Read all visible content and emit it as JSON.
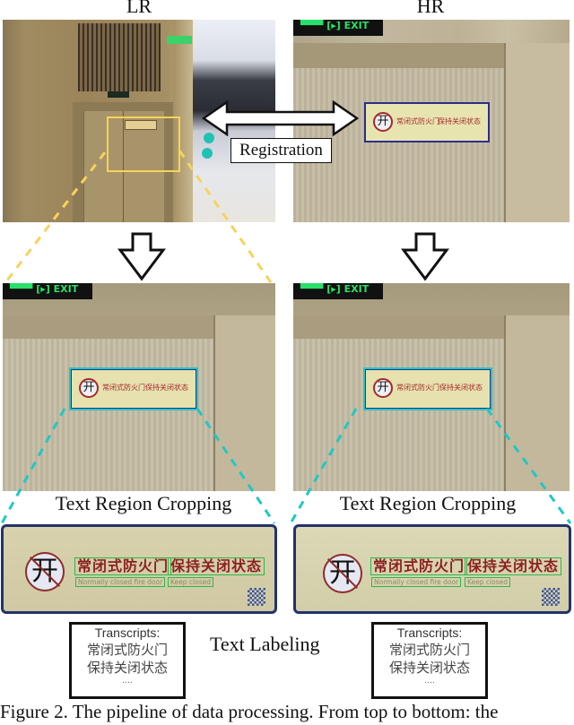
{
  "figure": {
    "column_labels": {
      "left": "LR",
      "right": "HR"
    },
    "registration_label": "Registration",
    "cropping_label_left": "Text Region Cropping",
    "cropping_label_right": "Text Region Cropping",
    "labeling_label": "Text Labeling",
    "caption": "Figure 2. The pipeline of data processing. From top to bottom: the"
  },
  "photos": {
    "exit_sign_text": "▀▀▀ [▸] EXIT",
    "sign_zh_1": "常闭式防火门",
    "sign_zh_2": "保持关闭状态",
    "sign_en_1": "Normally closed fire door",
    "sign_en_2": "Keep closed",
    "no_open_glyph": "开"
  },
  "crops": {
    "left": {
      "zh_1": "常闭式防火门",
      "zh_2": "保持关闭状态",
      "en_1": "Normally closed fire door",
      "en_2": "Keep closed",
      "glyph": "开"
    },
    "right": {
      "zh_1": "常闭式防火门",
      "zh_2": "保持关闭状态",
      "en_1": "Normally closed fire door",
      "en_2": "Keep closed",
      "glyph": "开"
    }
  },
  "transcripts": {
    "left": {
      "heading": "Transcripts:",
      "lines": [
        "常闭式防火门",
        "保持关闭状态"
      ],
      "ellipsis": "...."
    },
    "right": {
      "heading": "Transcripts:",
      "lines": [
        "常闭式防火门",
        "保持关闭状态"
      ],
      "ellipsis": "...."
    }
  },
  "colors": {
    "lr_roi": "#f7d35c",
    "text_roi": "#22c7c4",
    "text_box": "#2fb54a",
    "sign_text": "#8b1f1f",
    "sign_border": "#24326b"
  }
}
